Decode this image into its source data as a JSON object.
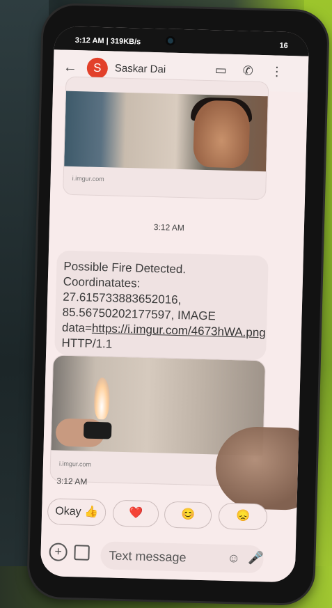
{
  "statusbar": {
    "left_text": "3:12 AM | 319KB/s",
    "right_text": "16"
  },
  "header": {
    "avatar_letter": "S",
    "contact_name": "Saskar Dai",
    "icons": [
      "back-arrow-icon",
      "video-call-icon",
      "phone-icon",
      "more-vert-icon"
    ]
  },
  "messages": {
    "top_card_host": "i.imgur.com",
    "time_1": "3:12 AM",
    "message_text_1": "Possible Fire Detected. Coordinatates: 27.615733883652016, 85.56750202177597,  IMAGE data=",
    "message_link": "https://i.imgur.com/4673hWA.png",
    "message_text_2": " HTTP/1.1",
    "bottom_card_host": "i.imgur.com",
    "time_2": "3:12 AM"
  },
  "quick_replies": [
    "Okay 👍",
    "❤️",
    "😊",
    "😞"
  ],
  "composer": {
    "placeholder": "Text message"
  },
  "colors": {
    "avatar_bg": "#e2402a",
    "screen_bg": "#f6eaea"
  }
}
